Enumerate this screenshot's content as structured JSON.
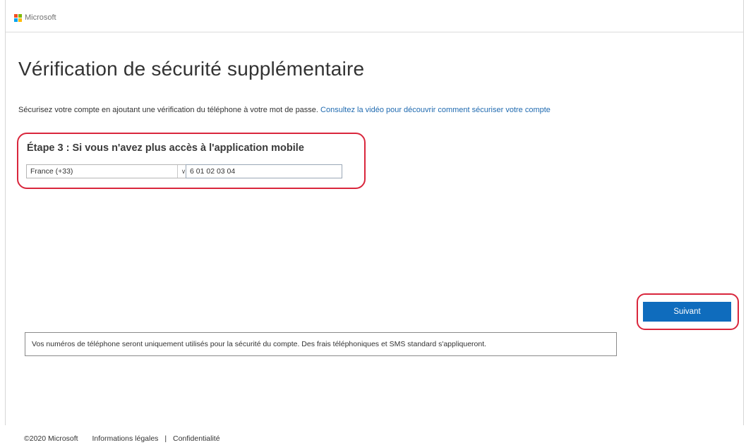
{
  "header": {
    "brand": "Microsoft",
    "logo_colors": [
      "#f25022",
      "#7fba00",
      "#00a4ef",
      "#ffb900"
    ]
  },
  "page": {
    "title": "Vérification de sécurité supplémentaire",
    "intro_text": "Sécurisez votre compte en ajoutant une vérification du téléphone à votre mot de passe.",
    "intro_link": "Consultez la vidéo pour découvrir comment sécuriser votre compte"
  },
  "step": {
    "title": "Étape 3 : Si vous n'avez plus accès à l'application mobile",
    "country_selected": "France (+33)",
    "phone_value": "6 01 02 03 04"
  },
  "actions": {
    "next_label": "Suivant"
  },
  "notice": {
    "text": "Vos numéros de téléphone seront uniquement utilisés pour la sécurité du compte. Des frais téléphoniques et SMS standard s'appliqueront."
  },
  "footer": {
    "copyright": "©2020 Microsoft",
    "legal": "Informations légales",
    "separator": "|",
    "privacy": "Confidentialité"
  },
  "colors": {
    "accent": "#0f6cbd",
    "highlight": "#d9263c",
    "link": "#1f6ab0"
  }
}
